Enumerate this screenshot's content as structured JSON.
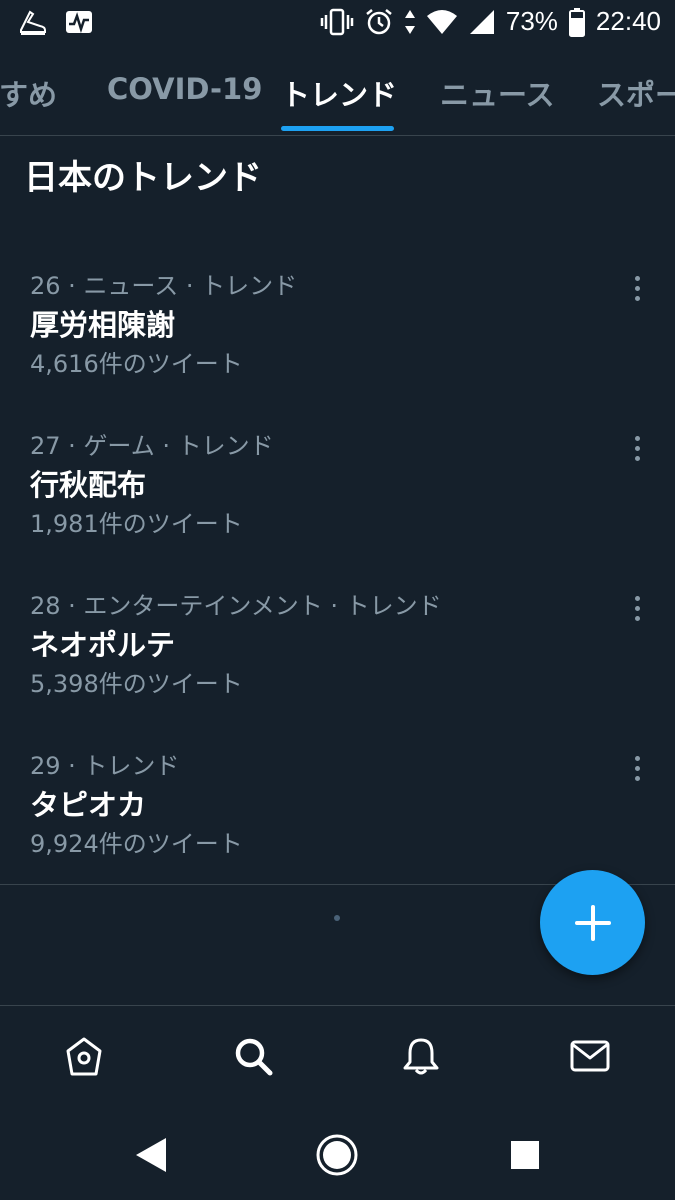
{
  "status_bar": {
    "battery_percent": "73%",
    "time": "22:40",
    "left_icons": [
      "running-shoe-icon",
      "activity-monitor-icon"
    ],
    "right_icons": [
      "vibrate-icon",
      "alarm-icon",
      "data-arrows-icon",
      "wifi-icon",
      "signal-icon",
      "battery-icon"
    ]
  },
  "tabs": [
    {
      "label": "すすめ",
      "active": false
    },
    {
      "label": "COVID-19",
      "active": false
    },
    {
      "label": "トレンド",
      "active": true
    },
    {
      "label": "ニュース",
      "active": false
    },
    {
      "label": "スポーツ",
      "active": false
    }
  ],
  "section_title": "日本のトレンド",
  "trends": [
    {
      "meta": "26 · ニュース · トレンド",
      "title": "厚労相陳謝",
      "count": "4,616件のツイート"
    },
    {
      "meta": "27 · ゲーム · トレンド",
      "title": "行秋配布",
      "count": "1,981件のツイート"
    },
    {
      "meta": "28 · エンターテインメント · トレンド",
      "title": "ネオポルテ",
      "count": "5,398件のツイート"
    },
    {
      "meta": "29 · トレンド",
      "title": "タピオカ",
      "count": "9,924件のツイート"
    }
  ],
  "fab": {
    "icon": "plus-icon"
  },
  "bottom_nav": [
    "home-icon",
    "search-icon",
    "bell-icon",
    "mail-icon"
  ],
  "system_nav": [
    "back-icon",
    "home-circle-icon",
    "recents-icon"
  ],
  "colors": {
    "background": "#15202b",
    "accent": "#1da1f2",
    "secondary_text": "#8899a6",
    "divider": "#38444d"
  }
}
